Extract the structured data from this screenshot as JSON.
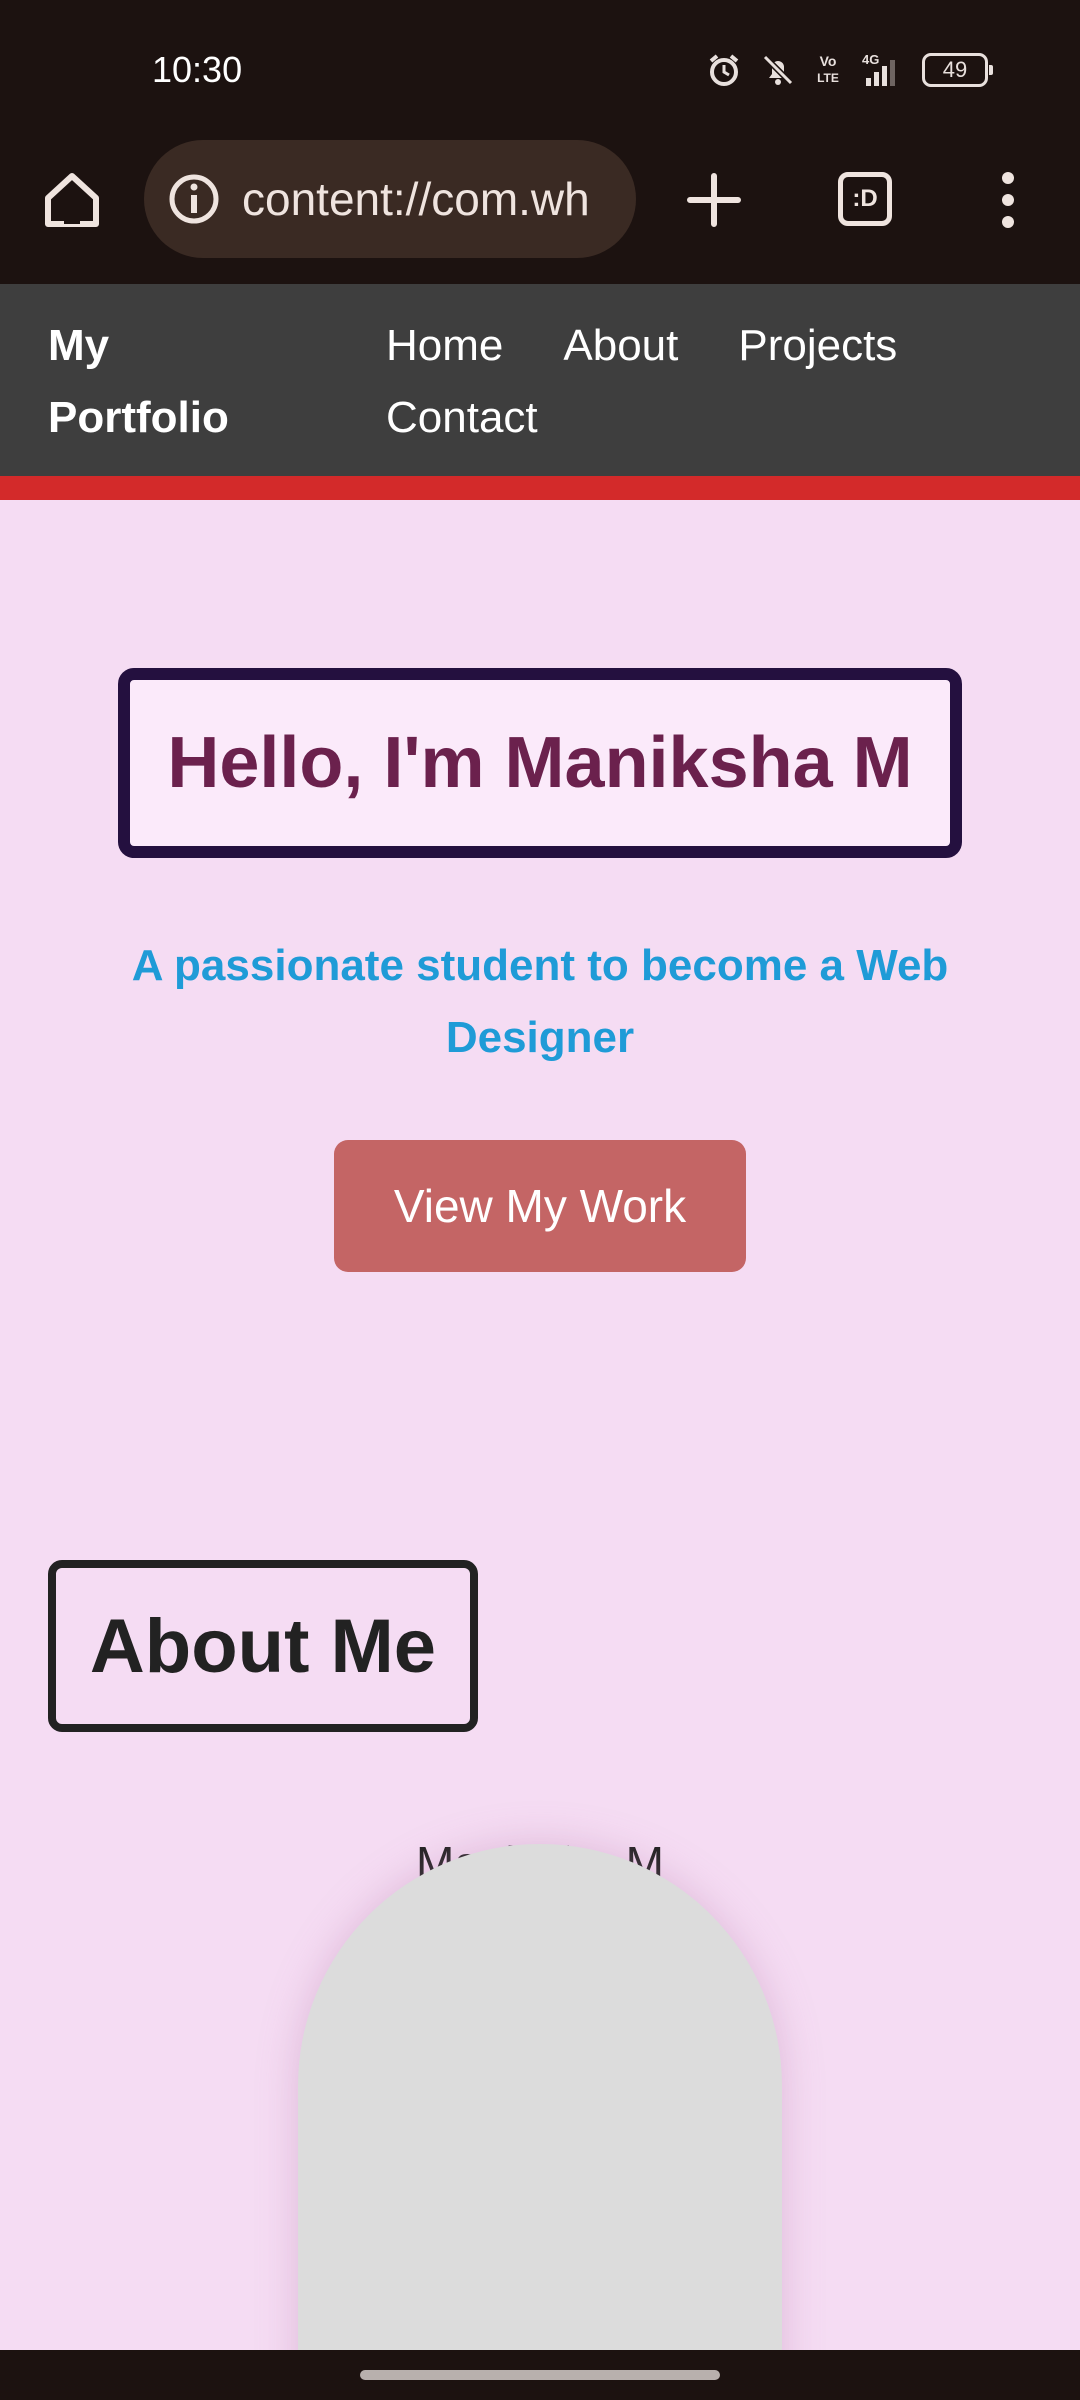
{
  "status_bar": {
    "time": "10:30",
    "icons": [
      "alarm-icon",
      "bell-off-icon",
      "volte-icon",
      "signal-4g-icon",
      "battery-icon"
    ],
    "volte_label": "Vo\nLTE",
    "network_label": "4G",
    "battery_level": "49"
  },
  "browser": {
    "url": "content://com.wh",
    "tabs_label": ":D",
    "icons": [
      "home-icon",
      "info-icon",
      "plus-icon",
      "tabs-icon",
      "more-vert-icon"
    ]
  },
  "site_nav": {
    "logo": "My Portfolio",
    "links": [
      "Home",
      "About",
      "Projects",
      "Contact"
    ]
  },
  "hero": {
    "title": "Hello, I'm Maniksha M",
    "subtitle": "A passionate student to become a Web Designer",
    "cta_label": "View My Work"
  },
  "about": {
    "title": "About Me",
    "image_alt": "Maniksha M"
  },
  "colors": {
    "system_bar": "#1c1210",
    "url_box": "#3a2a23",
    "nav_background": "#3e3e3e",
    "nav_accent": "#d32a2a",
    "page_background": "#f5dcf3",
    "hero_border": "#24103f",
    "hero_title": "#6b214d",
    "subtitle": "#1f9bd7",
    "cta_background": "#c46565",
    "avatar_placeholder": "#dcdcdc"
  }
}
